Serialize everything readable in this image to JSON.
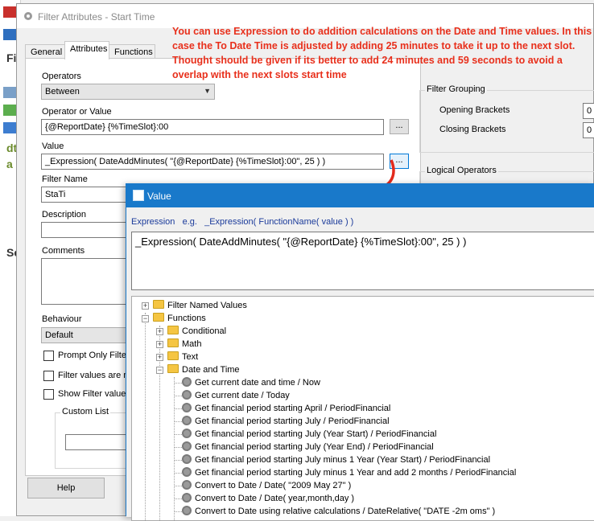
{
  "background_window": {
    "letters": [
      "Fi",
      "dt",
      "a",
      "Se"
    ]
  },
  "dialog": {
    "title": "Filter Attributes - Start Time",
    "tabs": [
      "General",
      "Attributes",
      "Functions"
    ],
    "operators_label": "Operators",
    "operators_value": "Between",
    "operator_or_value_label": "Operator or Value",
    "operator_or_value": "{@ReportDate} {%TimeSlot}:00",
    "browse_button": "...",
    "value_label": "Value",
    "value": "_Expression(  DateAddMinutes(  \"{@ReportDate} {%TimeSlot}:00\", 25 ) )",
    "value_button": "...",
    "filter_name_label": "Filter Name",
    "filter_name": "StaTi",
    "description_label": "Description",
    "comments_label": "Comments",
    "behaviour_label": "Behaviour",
    "behaviour_value": "Default",
    "prompt_only_filter": "Prompt Only Filter",
    "filter_values_are": "Filter values are m",
    "show_filter_values": "Show Filter values",
    "custom_list_label": "Custom List",
    "help_button": "Help",
    "filter_grouping_label": "Filter Grouping",
    "opening_brackets_label": "Opening Brackets",
    "opening_brackets_value": "0",
    "closing_brackets_label": "Closing Brackets",
    "closing_brackets_value": "0",
    "logical_operators_label": "Logical Operators"
  },
  "annotation": {
    "text": "You can use Expression to do addition calculations on the Date and Time values.  In this case the To Date Time is adjusted by adding 25 minutes to take it up to the next slot.  Thought should be given if its better to add 24 minutes and 59 seconds to avoid a overlap with the next slots start time",
    "color": "#e8301c"
  },
  "value_dialog": {
    "title": "Value",
    "hint": "Expression   e.g.   _Expression( FunctionName( value ) )",
    "expression": "_Expression(  DateAddMinutes(  \"{@ReportDate} {%TimeSlot}:00\", 25 ) )",
    "tree": {
      "filter_named_values": "Filter Named Values",
      "functions": "Functions",
      "conditional": "Conditional",
      "math": "Math",
      "text": "Text",
      "date_and_time": "Date and Time",
      "date_items": [
        "Get current date and time / Now",
        "Get current date / Today",
        "Get financial period starting April / PeriodFinancial",
        "Get financial period starting July / PeriodFinancial",
        "Get financial period starting July (Year Start) / PeriodFinancial",
        "Get financial period starting July (Year End) / PeriodFinancial",
        "Get financial period starting July minus 1 Year (Year Start) / PeriodFinancial",
        "Get financial period starting July minus 1 Year and add 2 months / PeriodFinancial",
        "Convert to Date / Date( \"2009 May 27\" )",
        "Convert to Date / Date( year,month,day )",
        "Convert to Date using relative calculations / DateRelative( \"DATE -2m oms\" )"
      ]
    }
  }
}
